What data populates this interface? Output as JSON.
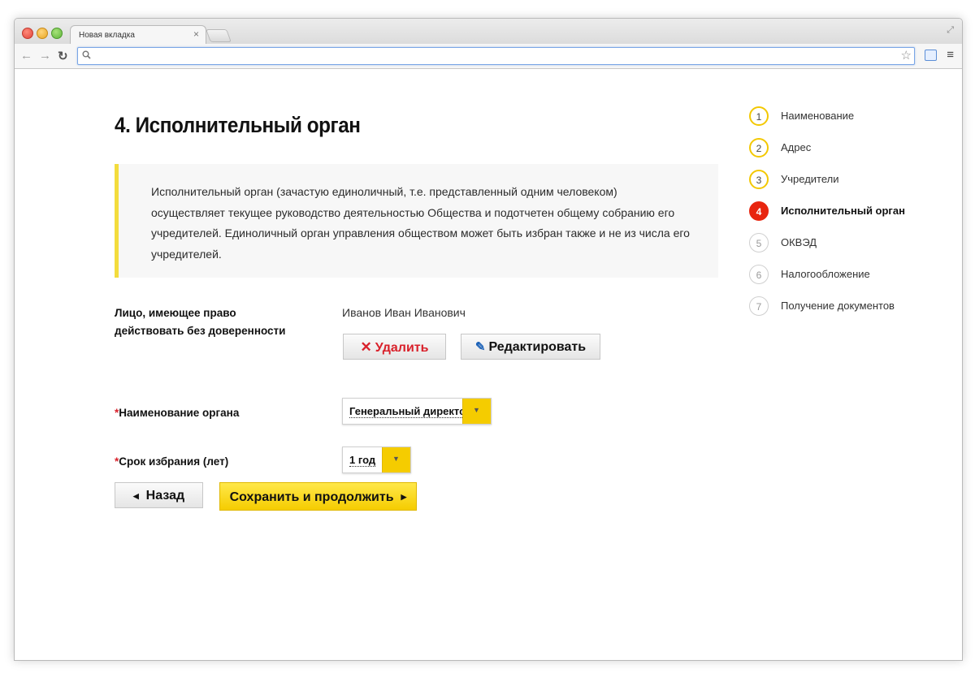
{
  "browser": {
    "tab_title": "Новая вкладка",
    "tab_close": "×",
    "address": ""
  },
  "page": {
    "title": "4. Исполнительный орган",
    "info": "Исполнительный орган (зачастую единоличный, т.е. представленный одним человеком) осуществляет текущее руководство деятельностью Общества и подотчетен общему собранию его учредителей. Единоличный орган управления обществом может быть избран также и не из числа его учредителей."
  },
  "form": {
    "person_label_line1": "Лицо, имеющее право",
    "person_label_line2": "действовать без доверенности",
    "person_value": "Иванов Иван Иванович",
    "delete_label": "Удалить",
    "edit_label": "Редактировать",
    "required_mark": "*",
    "organ_label": "Наименование органа",
    "organ_value": "Генеральный директор",
    "term_label": "Срок избрания (лет)",
    "term_value": "1 год",
    "back_label": "Назад",
    "save_label": "Сохранить и продолжить"
  },
  "steps": [
    {
      "num": "1",
      "label": "Наименование",
      "state": "done"
    },
    {
      "num": "2",
      "label": "Адрес",
      "state": "done"
    },
    {
      "num": "3",
      "label": "Учредители",
      "state": "done"
    },
    {
      "num": "4",
      "label": "Исполнительный орган",
      "state": "active"
    },
    {
      "num": "5",
      "label": "ОКВЭД",
      "state": "todo"
    },
    {
      "num": "6",
      "label": "Налогообложение",
      "state": "todo"
    },
    {
      "num": "7",
      "label": "Получение документов",
      "state": "todo"
    }
  ],
  "colors": {
    "accent_yellow": "#f5cc00",
    "active_step_red": "#e8250f",
    "delete_red": "#d9212b",
    "edit_blue": "#1d63b8"
  }
}
